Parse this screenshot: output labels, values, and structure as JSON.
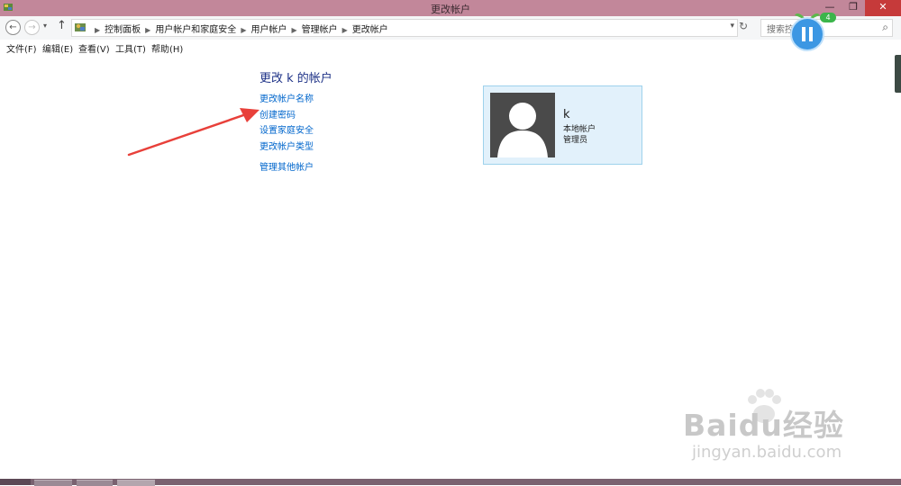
{
  "window": {
    "title": "更改帐户",
    "minimize_glyph": "—",
    "maximize_glyph": "❐",
    "close_glyph": "✕"
  },
  "nav": {
    "back_glyph": "←",
    "forward_glyph": "→",
    "recent_glyph": "▾",
    "up_glyph": "↑",
    "breadcrumbs": [
      "控制面板",
      "用户帐户和家庭安全",
      "用户帐户",
      "管理帐户",
      "更改帐户"
    ],
    "breadcrumb_sep": "▶",
    "address_dropdown_glyph": "▾",
    "refresh_glyph": "↻",
    "search_placeholder": "搜索控",
    "search_glyph": "⌕"
  },
  "menu": {
    "items": [
      "文件(F)",
      "编辑(E)",
      "查看(V)",
      "工具(T)",
      "帮助(H)"
    ]
  },
  "content": {
    "heading": "更改 k 的帐户",
    "links": [
      "更改帐户名称",
      "创建密码",
      "设置家庭安全",
      "更改帐户类型",
      "管理其他帐户"
    ]
  },
  "account": {
    "name": "k",
    "type": "本地帐户",
    "role": "管理员"
  },
  "overlay": {
    "badge_count": "4"
  },
  "watermark": {
    "logo": "Baidu经验",
    "url": "jingyan.baidu.com"
  },
  "colors": {
    "titlebar": "#c2879a",
    "link": "#0066cc",
    "heading": "#1e3287",
    "card_bg": "#e2f1fb",
    "card_border": "#9ed2ec",
    "annotation_arrow": "#e8403a"
  },
  "icons": [
    "control-panel-icon",
    "back-icon",
    "forward-icon",
    "up-icon",
    "refresh-icon",
    "search-icon",
    "avatar-icon",
    "arrow-annotation",
    "pause-icon",
    "paw-icon"
  ]
}
